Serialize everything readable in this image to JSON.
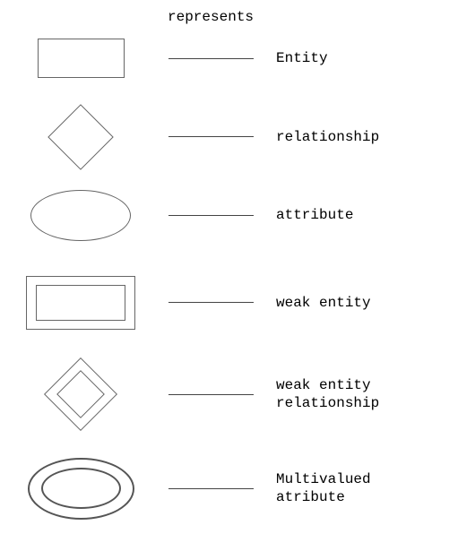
{
  "header": "represents",
  "legend": [
    {
      "shape": "rectangle",
      "label": "Entity"
    },
    {
      "shape": "diamond",
      "label": "relationship"
    },
    {
      "shape": "ellipse",
      "label": "attribute"
    },
    {
      "shape": "double-rectangle",
      "label": "weak entity"
    },
    {
      "shape": "double-diamond",
      "label": "weak entity\nrelationship"
    },
    {
      "shape": "double-ellipse",
      "label": "Multivalued\natribute"
    }
  ]
}
